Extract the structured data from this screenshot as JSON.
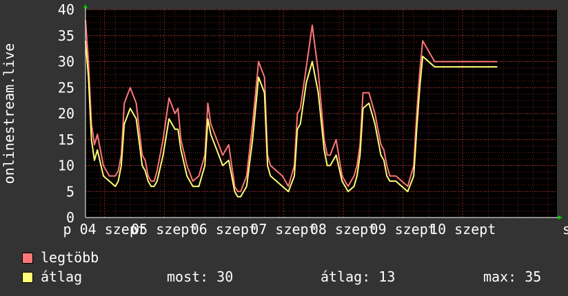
{
  "chart_data": {
    "type": "line",
    "ylabel": "onlinestream.live",
    "ylim": [
      0,
      40
    ],
    "yticks": [
      0,
      5,
      10,
      15,
      20,
      25,
      30,
      35,
      40
    ],
    "xlim": [
      0,
      7.9
    ],
    "xticks": [
      {
        "x": 0.32,
        "label": "p 04 szept"
      },
      {
        "x": 1.32,
        "label": "05 szept"
      },
      {
        "x": 2.32,
        "label": "06 szept"
      },
      {
        "x": 3.32,
        "label": "07 szept"
      },
      {
        "x": 4.32,
        "label": "08 szept"
      },
      {
        "x": 5.32,
        "label": "09 szept"
      },
      {
        "x": 6.32,
        "label": "10 szept"
      }
    ],
    "x_tail_label": "s",
    "grid": true,
    "background": "#000000",
    "colors": {
      "grid": "#6b2020",
      "axis": "#ffffff",
      "arrow": "#00cc00"
    },
    "series": [
      {
        "name": "legtöbb",
        "color": "#ff7777",
        "x": [
          0.0,
          0.05,
          0.1,
          0.15,
          0.2,
          0.3,
          0.4,
          0.5,
          0.55,
          0.6,
          0.65,
          0.75,
          0.85,
          0.95,
          1.0,
          1.05,
          1.1,
          1.15,
          1.2,
          1.3,
          1.4,
          1.5,
          1.55,
          1.6,
          1.7,
          1.8,
          1.9,
          2.0,
          2.05,
          2.1,
          2.2,
          2.3,
          2.4,
          2.5,
          2.55,
          2.6,
          2.7,
          2.8,
          2.9,
          3.0,
          3.05,
          3.1,
          3.2,
          3.3,
          3.4,
          3.5,
          3.55,
          3.6,
          3.7,
          3.8,
          3.9,
          4.0,
          4.05,
          4.1,
          4.2,
          4.3,
          4.4,
          4.5,
          4.55,
          4.6,
          4.65,
          4.75,
          4.85,
          4.95,
          5.0,
          5.05,
          5.1,
          5.2,
          5.3,
          5.4,
          5.5,
          5.55,
          5.6,
          5.65,
          5.75,
          5.85,
          5.95,
          6.0,
          6.05,
          6.1,
          6.2,
          6.3,
          6.4,
          6.5,
          6.6,
          6.7,
          6.75,
          6.8,
          6.85,
          6.9
        ],
        "values": [
          38,
          30,
          18,
          14,
          16,
          10,
          8,
          8,
          9,
          12,
          22,
          25,
          22,
          12,
          11,
          8,
          7,
          7,
          9,
          15,
          23,
          20,
          21,
          15,
          10,
          7,
          8,
          12,
          22,
          18,
          15,
          12,
          14,
          6,
          5,
          5,
          8,
          18,
          30,
          27,
          12,
          10,
          9,
          8,
          6,
          10,
          20,
          21,
          29,
          37,
          28,
          15,
          12,
          12,
          15,
          8,
          6,
          8,
          10,
          14,
          24,
          24,
          20,
          14,
          13,
          10,
          8,
          8,
          7,
          6,
          10,
          20,
          28,
          34,
          32,
          30,
          30,
          30,
          30,
          30,
          30,
          30,
          30,
          30,
          30,
          30,
          30,
          30,
          30,
          30
        ]
      },
      {
        "name": "átlag",
        "color": "#ffff77",
        "x": [
          0.0,
          0.05,
          0.1,
          0.15,
          0.2,
          0.3,
          0.4,
          0.5,
          0.55,
          0.6,
          0.65,
          0.75,
          0.85,
          0.95,
          1.0,
          1.05,
          1.1,
          1.15,
          1.2,
          1.3,
          1.4,
          1.5,
          1.55,
          1.6,
          1.7,
          1.8,
          1.9,
          2.0,
          2.05,
          2.1,
          2.2,
          2.3,
          2.4,
          2.5,
          2.55,
          2.6,
          2.7,
          2.8,
          2.9,
          3.0,
          3.05,
          3.1,
          3.2,
          3.3,
          3.4,
          3.5,
          3.55,
          3.6,
          3.7,
          3.8,
          3.9,
          4.0,
          4.05,
          4.1,
          4.2,
          4.3,
          4.4,
          4.5,
          4.55,
          4.6,
          4.65,
          4.75,
          4.85,
          4.95,
          5.0,
          5.05,
          5.1,
          5.2,
          5.3,
          5.4,
          5.5,
          5.55,
          5.6,
          5.65,
          5.75,
          5.85,
          5.95,
          6.0,
          6.05,
          6.1,
          6.2,
          6.3,
          6.4,
          6.5,
          6.6,
          6.7,
          6.75,
          6.8,
          6.85,
          6.9
        ],
        "values": [
          34,
          27,
          15,
          11,
          13,
          8,
          7,
          6,
          7,
          10,
          18,
          21,
          19,
          10,
          9,
          7,
          6,
          6,
          7,
          12,
          19,
          17,
          17,
          13,
          8,
          6,
          6,
          10,
          19,
          16,
          13,
          10,
          11,
          5,
          4,
          4,
          6,
          15,
          27,
          24,
          10,
          8,
          7,
          6,
          5,
          8,
          17,
          18,
          26,
          30,
          24,
          13,
          10,
          10,
          12,
          7,
          5,
          6,
          8,
          12,
          21,
          22,
          18,
          12,
          11,
          8,
          7,
          7,
          6,
          5,
          8,
          17,
          25,
          31,
          30,
          29,
          29,
          29,
          29,
          29,
          29,
          29,
          29,
          29,
          29,
          29,
          29,
          29,
          29,
          29
        ]
      }
    ]
  },
  "legend": [
    {
      "label": "legtöbb",
      "color": "#ff7777"
    },
    {
      "label": "átlag",
      "color": "#ffff77"
    }
  ],
  "stats": {
    "now": "most: 30",
    "avg": "átlag: 13",
    "max": "max: 35"
  }
}
